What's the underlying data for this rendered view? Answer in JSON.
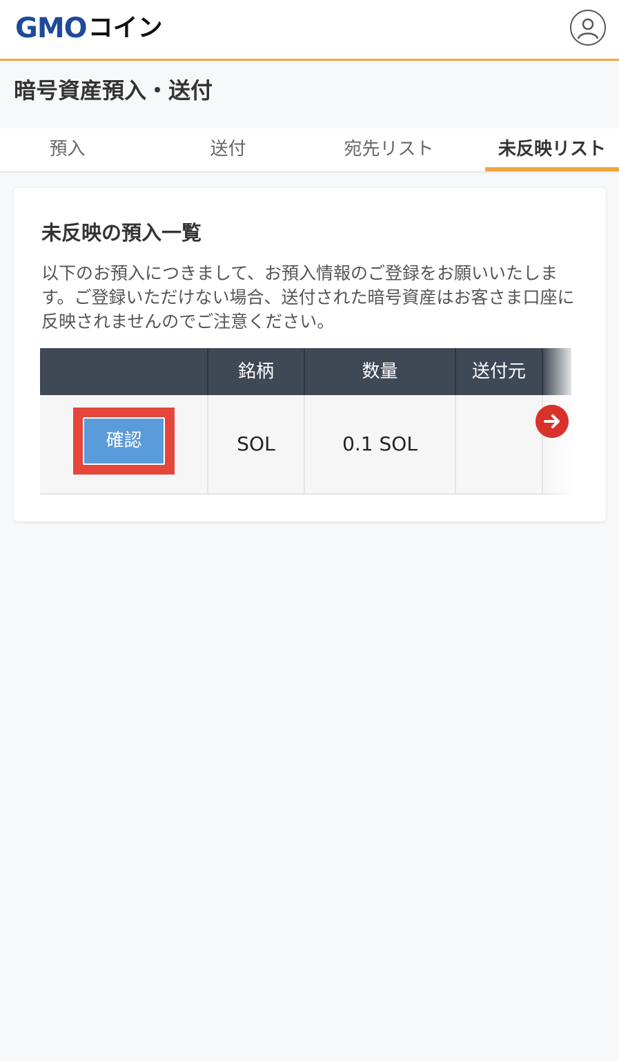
{
  "header": {
    "logo_gmo": "GMO",
    "logo_coin": "コイン",
    "user_icon": "user-circle-icon"
  },
  "page": {
    "title": "暗号資産預入・送付"
  },
  "tabs": [
    {
      "label": "預入",
      "active": false
    },
    {
      "label": "送付",
      "active": false
    },
    {
      "label": "宛先リスト",
      "active": false
    },
    {
      "label": "未反映リスト",
      "active": true
    }
  ],
  "card": {
    "title": "未反映の預入一覧",
    "description": "以下のお預入につきまして、お預入情報のご登録をお願いいたします。ご登録いただけない場合、送付された暗号資産はお客さま口座に反映されませんのでご注意ください。"
  },
  "table": {
    "headers": [
      "",
      "銘柄",
      "数量",
      "送付元"
    ],
    "rows": [
      {
        "action": "確認",
        "symbol": "SOL",
        "amount": "0.1 SOL",
        "source": ""
      }
    ]
  },
  "colors": {
    "accent": "#f0a640",
    "brand_blue": "#1e4a9a",
    "table_header": "#3f4855",
    "button_blue": "#5a9bd9",
    "highlight_red": "#e5453a"
  }
}
